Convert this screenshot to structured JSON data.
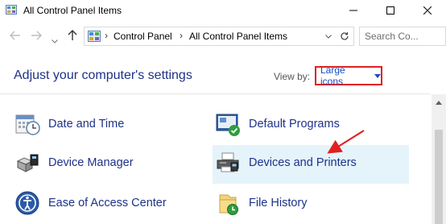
{
  "window": {
    "title": "All Control Panel Items",
    "accent": "#1e3287"
  },
  "address": {
    "crumbs": [
      "Control Panel",
      "All Control Panel Items"
    ],
    "search_placeholder": "Search Co..."
  },
  "header": {
    "heading": "Adjust your computer's settings",
    "view_by_label": "View by:",
    "view_by_value": "Large icons"
  },
  "items": [
    {
      "label": "Date and Time",
      "icon": "calendar-clock-icon"
    },
    {
      "label": "Default Programs",
      "icon": "default-programs-icon"
    },
    {
      "label": "Device Manager",
      "icon": "device-manager-icon"
    },
    {
      "label": "Devices and Printers",
      "icon": "printer-icon"
    },
    {
      "label": "Ease of Access Center",
      "icon": "ease-of-access-icon"
    },
    {
      "label": "File History",
      "icon": "file-history-icon"
    }
  ]
}
